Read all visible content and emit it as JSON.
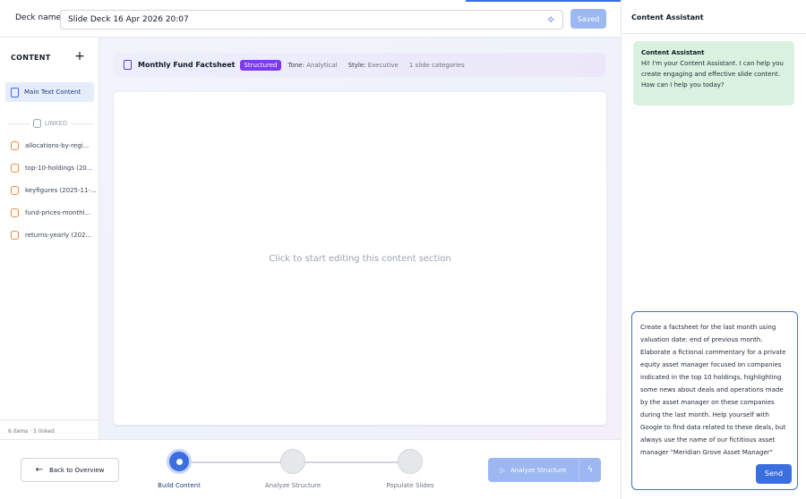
{
  "topbar": {
    "deck_label": "Deck name",
    "deck_name": "Slide Deck 16 Apr 2026 20:07",
    "saved_label": "Saved"
  },
  "sidebar": {
    "header": "CONTENT",
    "main_item": "Main Text Content",
    "linked_label": "LINKED",
    "linked_items": [
      {
        "label": "allocations-by-regi..."
      },
      {
        "label": "top-10-holdings (20..."
      },
      {
        "label": "keyfigures (2025-11-..."
      },
      {
        "label": "fund-prices-monthl..."
      },
      {
        "label": "returns-yearly (202..."
      }
    ],
    "footer": "6 items · 5 linked"
  },
  "infobar": {
    "title": "Monthly Fund Factsheet",
    "badge": "Structured",
    "tone_key": "Tone:",
    "tone_val": "Analytical",
    "style_key": "Style:",
    "style_val": "Executive",
    "categories": "1 slide categories"
  },
  "editor": {
    "placeholder": "Click to start editing this content section"
  },
  "bottom": {
    "back_label": "Back to Overview",
    "steps": [
      {
        "label": "Build Content"
      },
      {
        "label": "Analyze Structure"
      },
      {
        "label": "Populate Slides"
      }
    ],
    "analyze_label": "Analyze Structure"
  },
  "assistant": {
    "title": "Content Assistant",
    "bubble_title": "Content Assistant",
    "bubble_text": "Hi! I'm your Content Assistant. I can help you create engaging and effective slide content. How can I help you today?",
    "input_text": "Create a factsheet for the last month using valuation date: end of previous month. Elaborate a fictional commentary for a private equity asset manager focused on companies indicated in the top 10 holdings, highlighting some news about deals and operations made by the asset manager on these companies during the last month. Help yourself with Google to find data related to these deals, but always use the name of our fictitious asset manager \"Meridian Grove Asset Manager\"",
    "send_label": "Send"
  },
  "colors": {
    "accent": "#3b6fe0",
    "badge": "#7c3aed",
    "database_icon": "#f08a3e",
    "assistant_bubble": "#d9f2df"
  }
}
